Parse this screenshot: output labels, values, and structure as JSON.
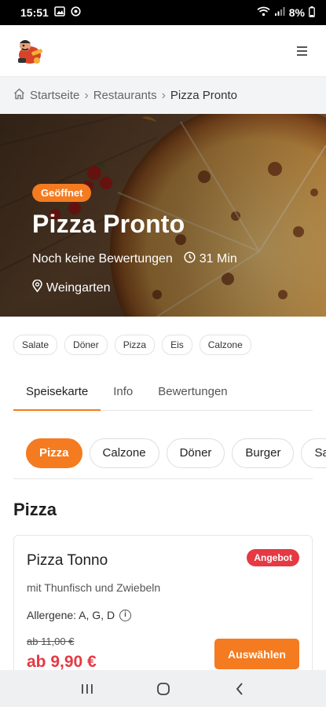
{
  "status_bar": {
    "time": "15:51",
    "battery": "8%"
  },
  "header": {
    "logo": "restaurant-mascot-logo",
    "menu_icon": "hamburger-icon"
  },
  "breadcrumb": {
    "items": [
      "Startseite",
      "Restaurants",
      "Pizza Pronto"
    ]
  },
  "hero": {
    "status": "Geöffnet",
    "title": "Pizza Pronto",
    "rating_text": "Noch keine Bewertungen",
    "delivery_time": "31 Min",
    "location": "Weingarten"
  },
  "cuisine_tags": [
    "Salate",
    "Döner",
    "Pizza",
    "Eis",
    "Calzone"
  ],
  "tabs": [
    "Speisekarte",
    "Info",
    "Bewertungen"
  ],
  "categories": [
    "Pizza",
    "Calzone",
    "Döner",
    "Burger",
    "Salate"
  ],
  "section": {
    "title": "Pizza"
  },
  "product": {
    "name": "Pizza Tonno",
    "badge": "Angebot",
    "description": "mit Thunfisch und Zwiebeln",
    "allergens": "Allergene: A, G, D",
    "old_price": "ab 11,00 €",
    "price": "ab 9,90 €",
    "button": "Auswählen"
  },
  "colors": {
    "accent": "#f47b20",
    "offer": "#e53943"
  }
}
